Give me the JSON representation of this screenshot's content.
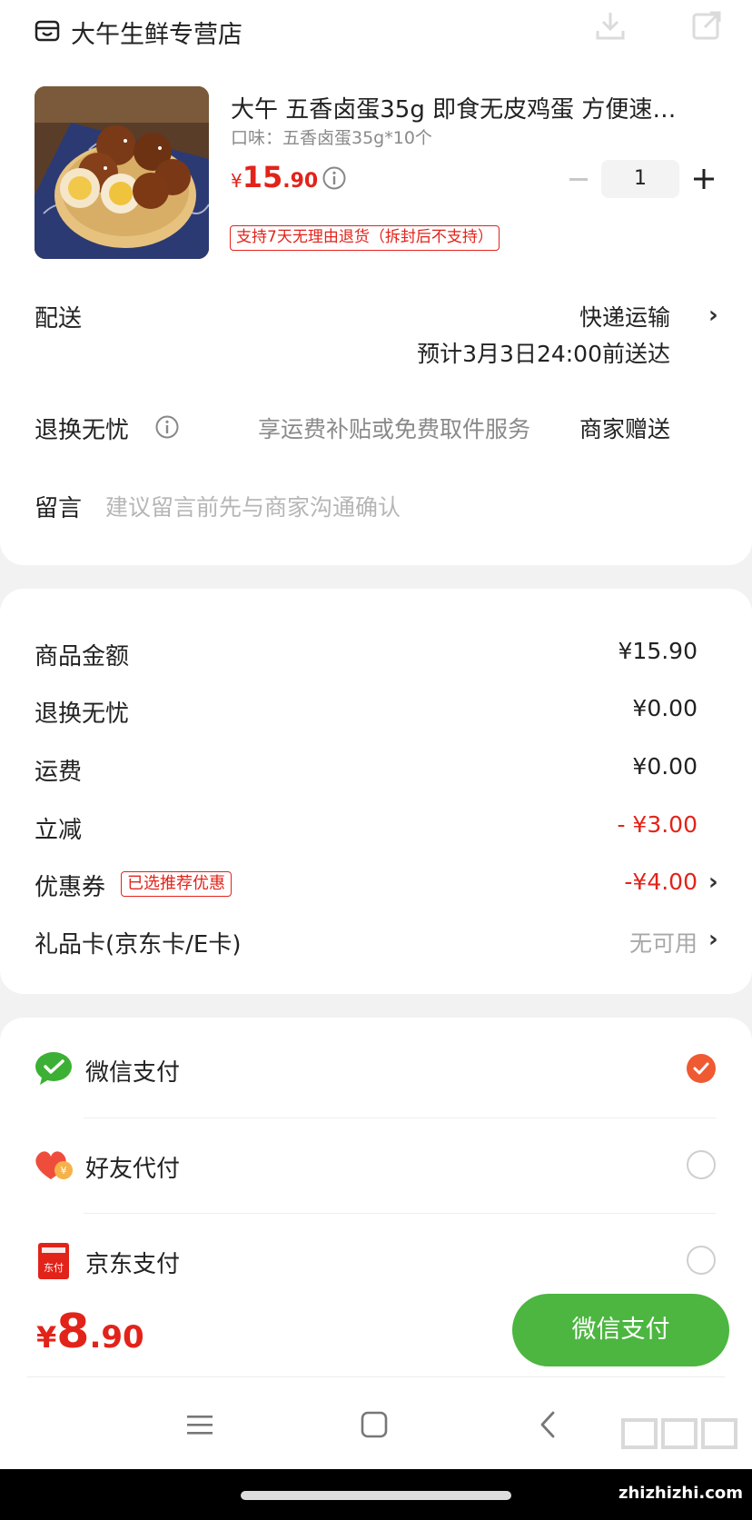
{
  "store": {
    "name": "大午生鲜专营店"
  },
  "product": {
    "title": "大午 五香卤蛋35g 即食无皮鸡蛋 方便速…",
    "variant": "口味：五香卤蛋35g*10个",
    "price_symbol": "¥",
    "price_int": "15",
    "price_dec": ".90",
    "quantity": "1",
    "return_tag": "支持7天无理由退货（拆封后不支持）"
  },
  "delivery": {
    "label": "配送",
    "method": "快递运输",
    "eta": "预计3月3日24:00前送达"
  },
  "worry_free": {
    "label": "退换无忧",
    "desc": "享运费补贴或免费取件服务",
    "value": "商家赠送"
  },
  "message": {
    "label": "留言",
    "placeholder": "建议留言前先与商家沟通确认"
  },
  "summary": [
    {
      "label": "商品金额",
      "value": "¥15.90",
      "tone": "normal"
    },
    {
      "label": "退换无忧",
      "value": "¥0.00",
      "tone": "normal"
    },
    {
      "label": "运费",
      "value": "¥0.00",
      "tone": "normal"
    },
    {
      "label": "立减",
      "value": "- ¥3.00",
      "tone": "red"
    },
    {
      "label": "优惠券",
      "value": "-¥4.00",
      "tone": "red",
      "tag": "已选推荐优惠"
    },
    {
      "label": "礼品卡(京东卡/E卡)",
      "value": "无可用",
      "tone": "grey"
    }
  ],
  "payment_methods": [
    {
      "label": "微信支付",
      "icon": "wechat-pay-icon",
      "selected": true
    },
    {
      "label": "好友代付",
      "icon": "friend-pay-icon",
      "selected": false
    },
    {
      "label": "京东支付",
      "icon": "jd-pay-icon",
      "selected": false
    }
  ],
  "footer": {
    "total_symbol": "¥",
    "total_int": "8",
    "total_dec": ".90",
    "pay_button": "微信支付"
  },
  "watermark": "zhizhizhi.com",
  "colors": {
    "accent_red": "#e2231a",
    "pay_green": "#4cb640",
    "radio_selected": "#ef5a33"
  }
}
